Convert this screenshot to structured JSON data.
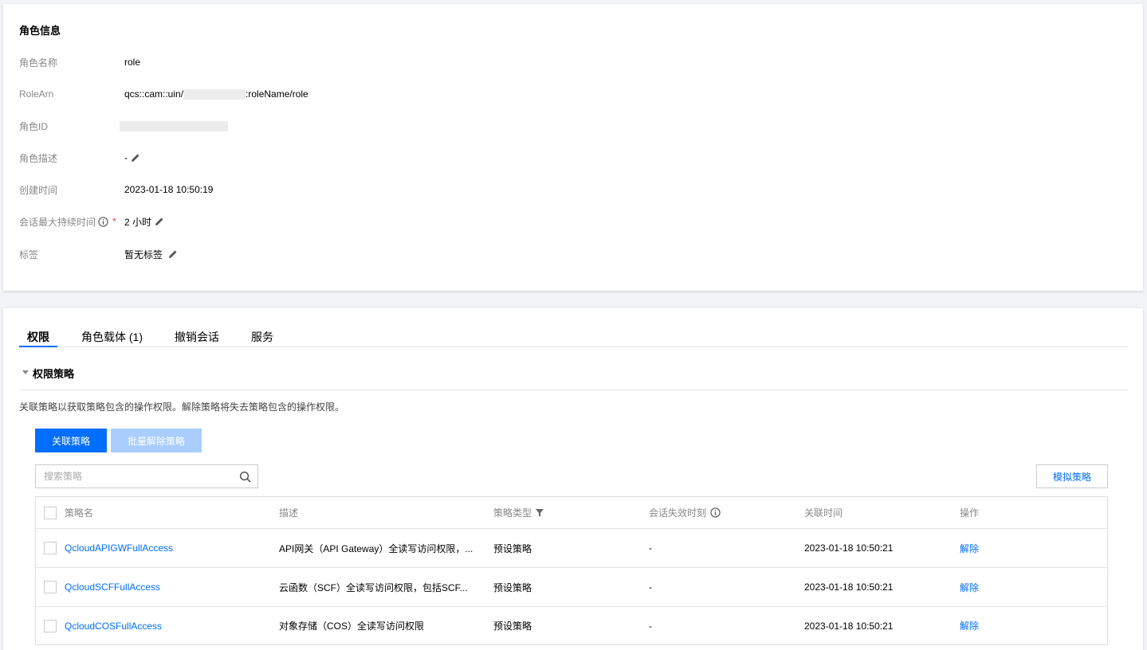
{
  "role_info": {
    "title": "角色信息",
    "name_label": "角色名称",
    "name_value": "role",
    "arn_label": "RoleArn",
    "arn_prefix": "qcs::cam::uin/",
    "arn_suffix": ":roleName/role",
    "id_label": "角色ID",
    "desc_label": "角色描述",
    "desc_value": "-",
    "created_label": "创建时间",
    "created_value": "2023-01-18 10:50:19",
    "session_label": "会话最大持续时间",
    "session_required": "*",
    "session_value": "2 小时",
    "tags_label": "标签",
    "tags_value": "暂无标签"
  },
  "tabs": [
    {
      "label": "权限"
    },
    {
      "label": "角色载体 (1)"
    },
    {
      "label": "撤销会话"
    },
    {
      "label": "服务"
    }
  ],
  "permissions": {
    "section_title": "权限策略",
    "description": "关联策略以获取策略包含的操作权限。解除策略将失去策略包含的操作权限。",
    "attach_button": "关联策略",
    "batch_detach_button": "批量解除策略",
    "search_placeholder": "搜索策略",
    "simulate_button": "模拟策略",
    "columns": {
      "name": "策略名",
      "desc": "描述",
      "type": "策略类型",
      "expire": "会话失效时刻",
      "time": "关联时间",
      "action": "操作"
    },
    "rows": [
      {
        "name": "QcloudAPIGWFullAccess",
        "desc": "API网关（API Gateway）全读写访问权限，...",
        "type": "预设策略",
        "expire": "-",
        "time": "2023-01-18 10:50:21",
        "action": "解除"
      },
      {
        "name": "QcloudSCFFullAccess",
        "desc": "云函数（SCF）全读写访问权限，包括SCF...",
        "type": "预设策略",
        "expire": "-",
        "time": "2023-01-18 10:50:21",
        "action": "解除"
      },
      {
        "name": "QcloudCOSFullAccess",
        "desc": "对象存储（COS）全读写访问权限",
        "type": "预设策略",
        "expire": "-",
        "time": "2023-01-18 10:50:21",
        "action": "解除"
      }
    ]
  },
  "colors": {
    "primary": "#006eff",
    "disabled": "#a9cdff",
    "required": "#e54545"
  }
}
